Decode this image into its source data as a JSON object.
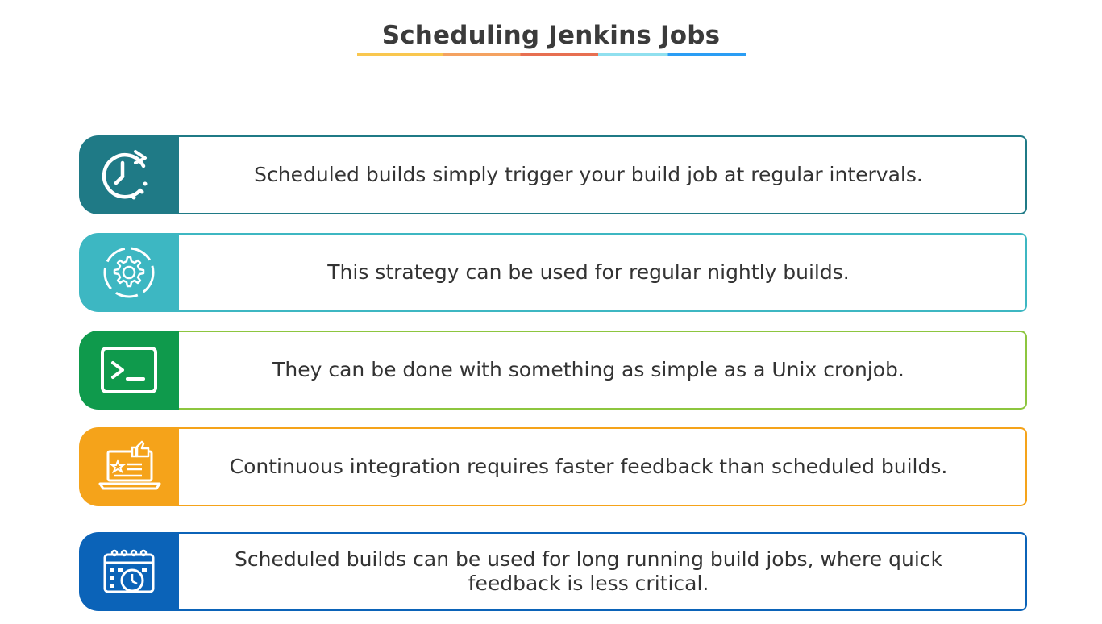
{
  "title": "Scheduling Jenkins Jobs",
  "colors": {
    "teal_dark": "#1f7a86",
    "teal_light": "#3db7c2",
    "green": "#0f9a4c",
    "orange": "#f5a31a",
    "blue": "#0b63b8"
  },
  "items": [
    {
      "icon": "clock-rotate-icon",
      "text": "Scheduled builds simply trigger your build job at regular intervals."
    },
    {
      "icon": "gear-cycle-icon",
      "text": "This strategy can be used for regular nightly builds."
    },
    {
      "icon": "terminal-icon",
      "text": "They can be done with something as simple as a Unix cronjob."
    },
    {
      "icon": "laptop-feedback-icon",
      "text": "Continuous integration requires faster feedback than scheduled builds."
    },
    {
      "icon": "calendar-clock-icon",
      "text": "Scheduled builds can be used for long running build jobs, where quick feedback is less critical."
    }
  ]
}
